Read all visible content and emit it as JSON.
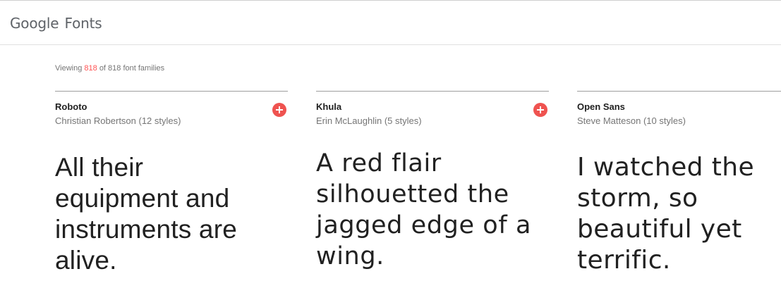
{
  "header": {
    "logo_google": "Google",
    "logo_fonts": "Fonts"
  },
  "results": {
    "viewing_prefix": "Viewing",
    "viewing_count": "818",
    "viewing_suffix": "of 818 font families"
  },
  "cards": [
    {
      "family": "Roboto",
      "designer": "Christian Robertson (12 styles)",
      "sample_lines": [
        "All their",
        "equipment and",
        "instruments are",
        "alive."
      ],
      "add_icon": "plus-circle-icon"
    },
    {
      "family": "Khula",
      "designer": "Erin McLaughlin (5 styles)",
      "sample_lines": [
        "A red flair",
        "silhouetted the",
        "jagged edge of a",
        "wing."
      ],
      "add_icon": "plus-circle-icon"
    },
    {
      "family": "Open Sans",
      "designer": "Steve Matteson (10 styles)",
      "sample_lines": [
        "I watched the",
        "storm, so",
        "beautiful yet",
        "terrific."
      ]
    }
  ],
  "colors": {
    "accent": "#ef5350",
    "count_highlight": "#ff5252",
    "text_primary": "#212121",
    "text_secondary": "#757575"
  }
}
